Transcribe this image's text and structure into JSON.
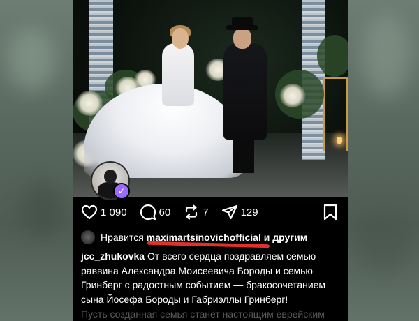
{
  "post": {
    "stats": {
      "likes": "1 090",
      "comments": "60",
      "reposts": "7",
      "shares": "129"
    },
    "liked_by": {
      "prefix": "Нравится",
      "user": "maximartsinovichofficial",
      "suffix": "и другим"
    },
    "caption": {
      "username": "jcc_zhukovka",
      "lines": [
        "От всего сердца поздравляем семью",
        "раввина Александра Моисеевича Бороды и семью",
        "Гринберг с радостным событием — бракосочетанием",
        "сына Йосефа Бороды и Габриэллы Гринберг!"
      ],
      "next_line_partial": "Пусть созданная семья станет настоящим еврейским"
    },
    "colors": {
      "underline": "#e0312a",
      "verified_badge": "#9a6bff",
      "background": "#000000"
    },
    "icons": [
      "heart-icon",
      "comment-icon",
      "repost-icon",
      "share-icon",
      "bookmark-icon"
    ]
  }
}
